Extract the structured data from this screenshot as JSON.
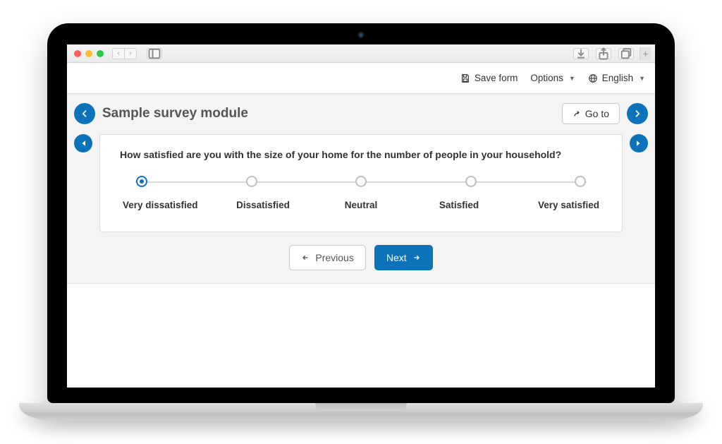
{
  "toolbar": {
    "save_label": "Save form",
    "options_label": "Options",
    "language_label": "English"
  },
  "header": {
    "title": "Sample survey module",
    "goto_label": "Go to"
  },
  "survey": {
    "question": "How satisfied are you with the size of your home for the number of people in your household?",
    "options": [
      {
        "label": "Very dissatisfied"
      },
      {
        "label": "Dissatisfied"
      },
      {
        "label": "Neutral"
      },
      {
        "label": "Satisfied"
      },
      {
        "label": "Very satisfied"
      }
    ],
    "selected_index": 0
  },
  "nav": {
    "prev_label": "Previous",
    "next_label": "Next"
  }
}
